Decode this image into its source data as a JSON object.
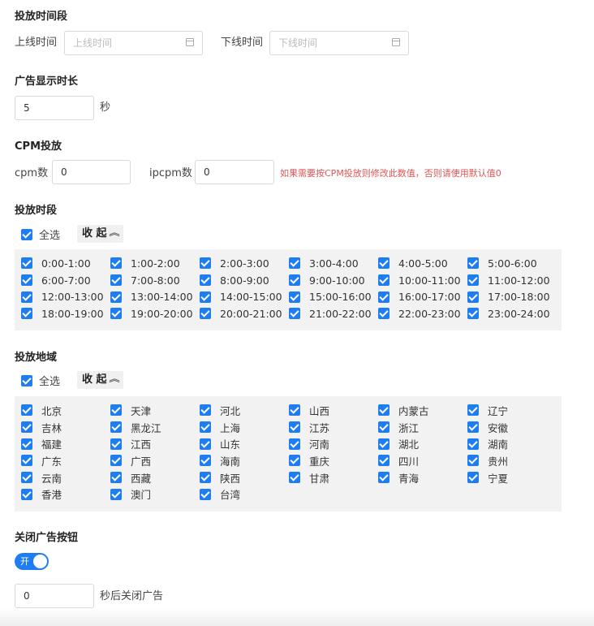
{
  "schedule": {
    "title": "投放时间段",
    "start_label": "上线时间",
    "start_placeholder": "上线时间",
    "end_label": "下线时间",
    "end_placeholder": "下线时间"
  },
  "duration": {
    "title": "广告显示时长",
    "value": "5",
    "unit": "秒"
  },
  "cpm": {
    "title": "CPM投放",
    "cpm_label": "cpm数",
    "cpm_value": "0",
    "ipcpm_label": "ipcpm数",
    "ipcpm_value": "0",
    "hint": "如果需要按CPM投放则修改此数值，否则请使用默认值0"
  },
  "periods": {
    "title": "投放时段",
    "select_all": "全选",
    "collapse": "收 起",
    "items": [
      "0:00-1:00",
      "1:00-2:00",
      "2:00-3:00",
      "3:00-4:00",
      "4:00-5:00",
      "5:00-6:00",
      "6:00-7:00",
      "7:00-8:00",
      "8:00-9:00",
      "9:00-10:00",
      "10:00-11:00",
      "11:00-12:00",
      "12:00-13:00",
      "13:00-14:00",
      "14:00-15:00",
      "15:00-16:00",
      "16:00-17:00",
      "17:00-18:00",
      "18:00-19:00",
      "19:00-20:00",
      "20:00-21:00",
      "21:00-22:00",
      "22:00-23:00",
      "23:00-24:00"
    ]
  },
  "regions": {
    "title": "投放地域",
    "select_all": "全选",
    "collapse": "收 起",
    "items": [
      "北京",
      "天津",
      "河北",
      "山西",
      "内蒙古",
      "辽宁",
      "吉林",
      "黑龙江",
      "上海",
      "江苏",
      "浙江",
      "安徽",
      "福建",
      "江西",
      "山东",
      "河南",
      "湖北",
      "湖南",
      "广东",
      "广西",
      "海南",
      "重庆",
      "四川",
      "贵州",
      "云南",
      "西藏",
      "陕西",
      "甘肃",
      "青海",
      "宁夏",
      "香港",
      "澳门",
      "台湾"
    ]
  },
  "close_button": {
    "title": "关闭广告按钮",
    "toggle_label": "开",
    "toggle_on": true,
    "seconds_value": "0",
    "seconds_suffix": "秒后关闭广告"
  },
  "colors": {
    "accent": "#1e7ef1",
    "hint": "#e05555",
    "panel": "#f2f2f2"
  }
}
